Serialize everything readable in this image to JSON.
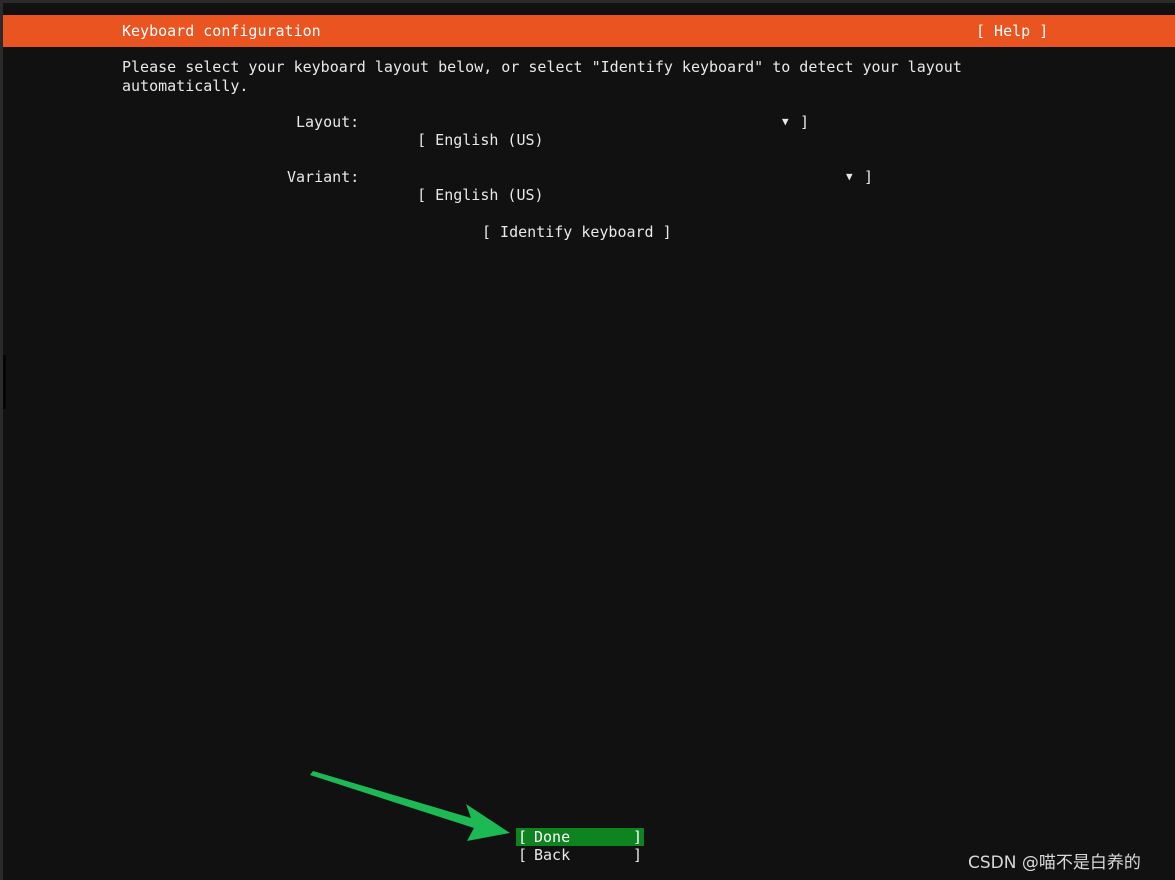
{
  "header": {
    "title": "Keyboard configuration",
    "help_label": "[ Help ]",
    "background_color": "#e95420"
  },
  "description": "Please select your keyboard layout below, or select \"Identify keyboard\" to detect your layout automatically.",
  "layout_field": {
    "label": "Layout:",
    "value": "[ English (US)",
    "arrow": "▼",
    "close_bracket": "]"
  },
  "variant_field": {
    "label": "Variant:",
    "value": "[ English (US)",
    "arrow": "▼",
    "close_bracket": "]"
  },
  "identify_button": {
    "label": "[ Identify keyboard ]"
  },
  "buttons": {
    "done": {
      "open": "[",
      "label": "Done",
      "close": "]",
      "highlight_color": "#0e8420"
    },
    "back": {
      "open": "[",
      "label": "Back",
      "close": "]"
    }
  },
  "annotation": {
    "arrow_color": "#1db954"
  },
  "watermark": "CSDN @喵不是白养的"
}
